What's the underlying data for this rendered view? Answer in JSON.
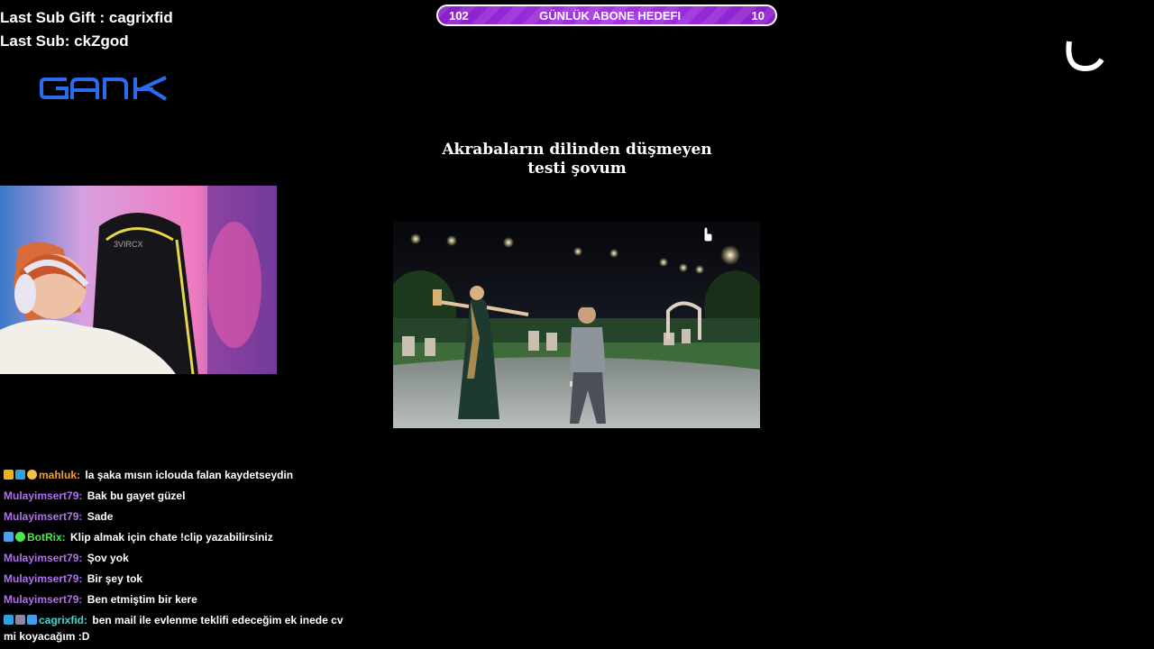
{
  "overlay": {
    "last_sub_gift": "Last Sub Gift : cagrixfid",
    "last_sub": "Last Sub: ckZgod",
    "logo_text": "GANK",
    "brand_color": "#2a6cf0"
  },
  "goal": {
    "current": "102",
    "label": "GÜNLÜK ABONE HEDEFI",
    "target": "10",
    "color": "#a52fe0"
  },
  "video": {
    "title_line1": "Akrabaların dilinden düşmeyen",
    "title_line2": "testi şovum"
  },
  "chat": {
    "messages": [
      {
        "user": "mahluk:",
        "text": "la şaka mısın iclouda falan kaydetseydin",
        "user_color": "#f0a030",
        "badges": [
          "crown-icon",
          "grid-icon",
          "gold-coin-icon"
        ]
      },
      {
        "user": "Mulayimsert79:",
        "text": "Bak bu gayet güzel",
        "user_color": "#b070f0",
        "badges": []
      },
      {
        "user": "Mulayimsert79:",
        "text": "Sade",
        "user_color": "#b070f0",
        "badges": []
      },
      {
        "user": "BotRix:",
        "text": "Klip almak için chate !clip yazabilirsiniz",
        "user_color": "#4ee64e",
        "badges": [
          "sword-icon",
          "gear-icon"
        ]
      },
      {
        "user": "Mulayimsert79:",
        "text": "Şov yok",
        "user_color": "#b070f0",
        "badges": []
      },
      {
        "user": "Mulayimsert79:",
        "text": "Bir şey tok",
        "user_color": "#b070f0",
        "badges": []
      },
      {
        "user": "Mulayimsert79:",
        "text": "Ben etmiştim bir kere",
        "user_color": "#b070f0",
        "badges": []
      },
      {
        "user": "cagrixfid:",
        "text": "ben mail ile evlenme teklifi edeceğim ek inede cv mi koyacağım :D",
        "user_color": "#3fd8d0",
        "badges": [
          "grid-icon",
          "ship-icon",
          "cube-icon"
        ]
      }
    ]
  }
}
